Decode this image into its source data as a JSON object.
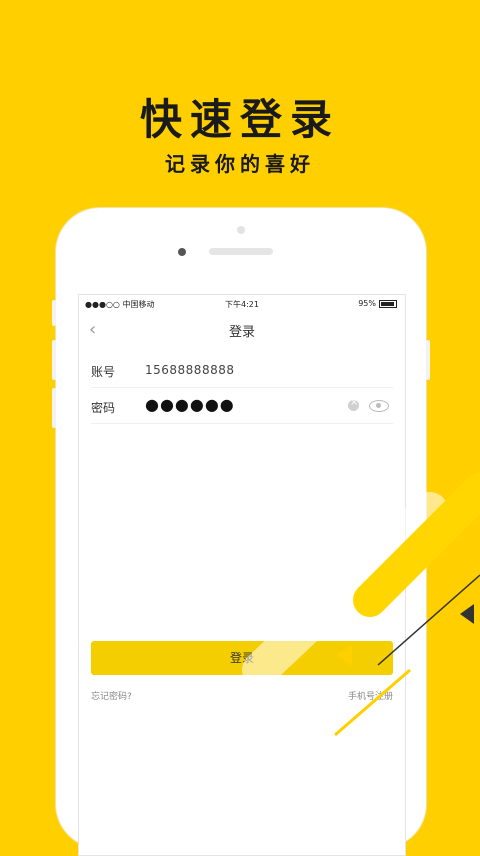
{
  "promo": {
    "title": "快速登录",
    "subtitle": "记录你的喜好"
  },
  "status_bar": {
    "carrier": "●●●○○ 中国移动 ",
    "time": "下午4:21",
    "battery": "95%"
  },
  "nav": {
    "title": "登录",
    "back_icon": "‹"
  },
  "form": {
    "account_label": "账号",
    "account_value": "15688888888",
    "password_label": "密码",
    "password_value": "●●●●●●"
  },
  "login_button": "登录",
  "links": {
    "forgot_password": "忘记密码?",
    "phone_register": "手机号注册"
  },
  "colors": {
    "background": "#FFCF00",
    "button": "#F5CE00"
  }
}
